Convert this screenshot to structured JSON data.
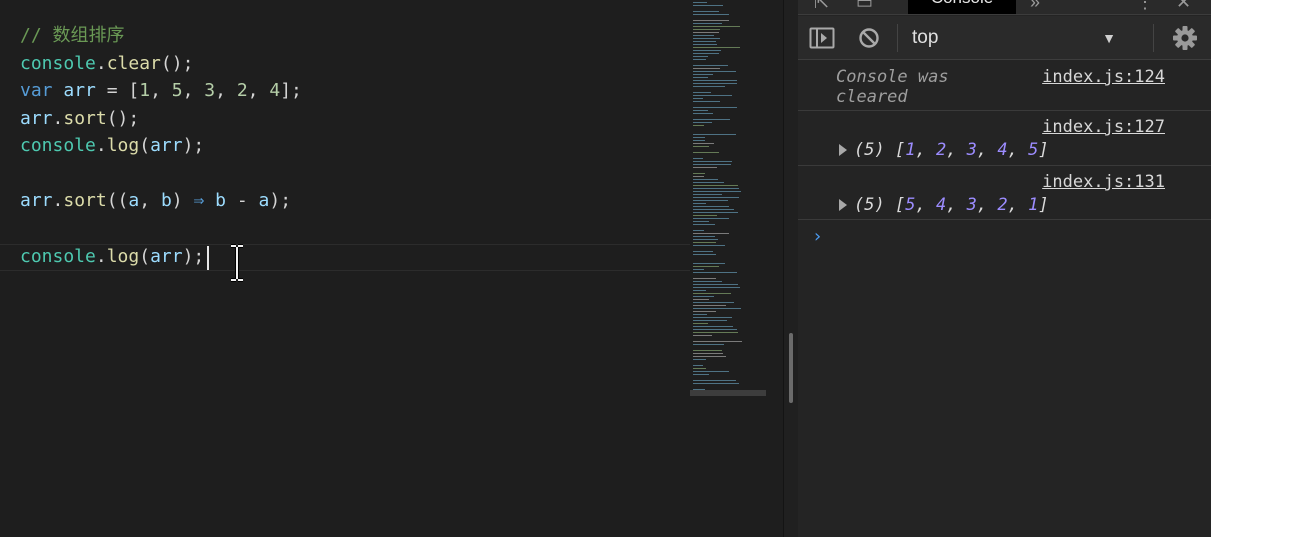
{
  "editor": {
    "lines": {
      "l1": {
        "comment": "// 数组排序"
      },
      "l2": {
        "obj": "console",
        "dot": ".",
        "fn": "clear",
        "rest": "();"
      },
      "l3": {
        "kw": "var",
        "sp1": " ",
        "name": "arr",
        "eq": " = [",
        "n1": "1",
        "c1": ", ",
        "n2": "5",
        "c2": ", ",
        "n3": "3",
        "c3": ", ",
        "n4": "2",
        "c4": ", ",
        "n5": "4",
        "end": "];"
      },
      "l4": {
        "name": "arr",
        "dot": ".",
        "fn": "sort",
        "rest": "();"
      },
      "l5": {
        "obj": "console",
        "dot": ".",
        "fn": "log",
        "open": "(",
        "arg": "arr",
        "close": ");"
      },
      "l6": {
        "name": "arr",
        "dot": ".",
        "fn": "sort",
        "open": "((",
        "a": "a",
        "comma": ", ",
        "b": "b",
        "close1": ") ",
        "arrow": "⇒",
        "sp": " ",
        "b2": "b",
        "minus": " - ",
        "a2": "a",
        "close2": ");"
      },
      "l7": {
        "obj": "console",
        "dot": ".",
        "fn": "log",
        "open": "(",
        "arg": "arr",
        "close": ");"
      }
    },
    "colors": {
      "background": "#1e1e1e",
      "comment": "#6a9955",
      "keyword": "#569cd6",
      "number": "#b5cea8"
    }
  },
  "devtools": {
    "active_tab": "Console",
    "toolbar": {
      "context": "top",
      "icons": [
        "toggle-sidebar-icon",
        "clear-console-icon",
        "chevron-down-icon",
        "settings-icon"
      ]
    },
    "console": {
      "entries": [
        {
          "text": "Console was cleared",
          "source": "index.js:124"
        },
        {
          "source": "index.js:127",
          "count": "(5)",
          "values": [
            "1",
            "2",
            "3",
            "4",
            "5"
          ]
        },
        {
          "source": "index.js:131",
          "count": "(5)",
          "values": [
            "5",
            "4",
            "3",
            "2",
            "1"
          ]
        }
      ],
      "prompt_symbol": "›"
    },
    "colors": {
      "background": "#242424",
      "number": "#9c8cff",
      "prompt": "#4b9bf0"
    }
  }
}
